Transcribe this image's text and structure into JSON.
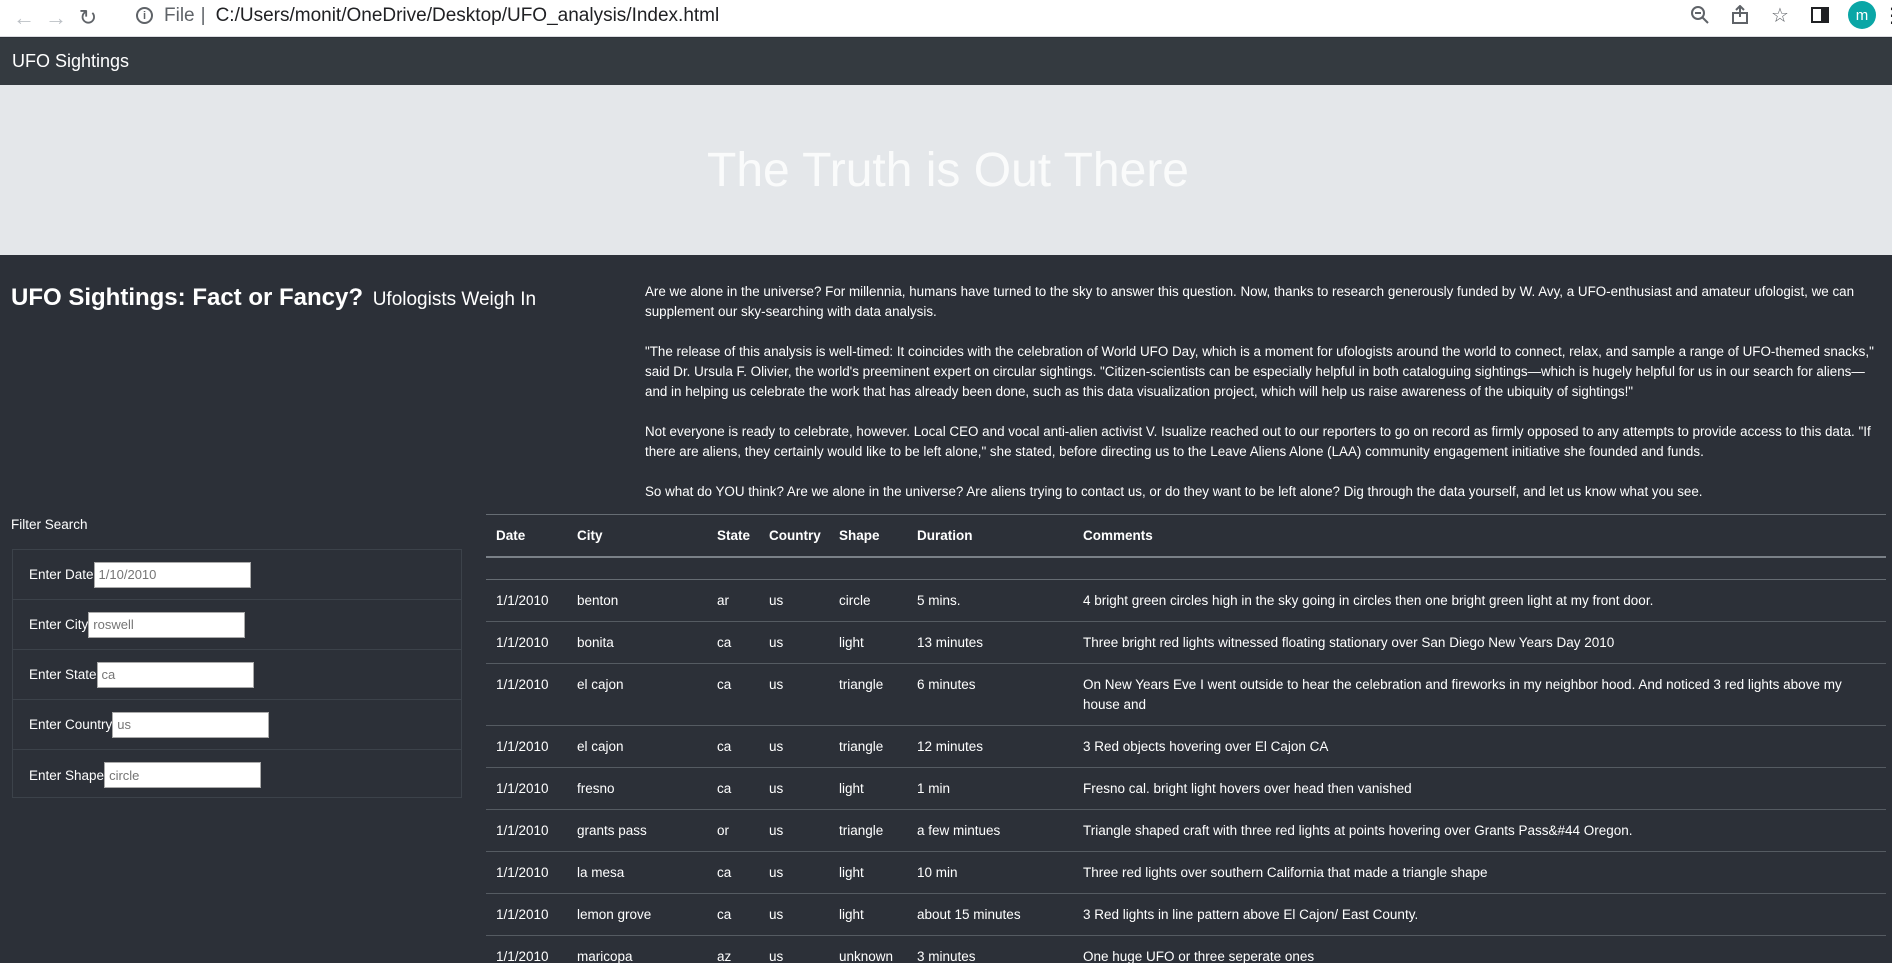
{
  "browser": {
    "file_label": "File",
    "separator": "|",
    "url": "C:/Users/monit/OneDrive/Desktop/UFO_analysis/Index.html",
    "profile_initial": "m",
    "icons": [
      "back-arrow-icon",
      "forward-arrow-icon",
      "reload-icon",
      "info-icon",
      "zoom-out-icon",
      "share-icon",
      "star-icon",
      "side-panel-icon",
      "kebab-menu-icon"
    ]
  },
  "navbar": {
    "brand": "UFO Sightings"
  },
  "jumbotron": {
    "title": "The Truth is Out There"
  },
  "article": {
    "title": "UFO Sightings: Fact or Fancy?",
    "subtitle": "Ufologists Weigh In",
    "paragraphs": [
      "Are we alone in the universe? For millennia, humans have turned to the sky to answer this question. Now, thanks to research generously funded by W. Avy, a UFO-enthusiast and amateur ufologist, we can supplement our sky-searching with data analysis.",
      "\"The release of this analysis is well-timed: It coincides with the celebration of World UFO Day, which is a moment for ufologists around the world to connect, relax, and sample a range of UFO-themed snacks,\" said Dr. Ursula F. Olivier, the world's preeminent expert on circular sightings. \"Citizen-scientists can be especially helpful in both cataloguing sightings—which is hugely helpful for us in our search for aliens—and in helping us celebrate the work that has already been done, such as this data visualization project, which will help us raise awareness of the ubiquity of sightings!\"",
      "Not everyone is ready to celebrate, however. Local CEO and vocal anti-alien activist V. Isualize reached out to our reporters to go on record as firmly opposed to any attempts to provide access to this data. \"If there are aliens, they certainly would like to be left alone,\" she stated, before directing us to the Leave Aliens Alone (LAA) community engagement initiative she founded and funds.",
      "So what do YOU think? Are we alone in the universe? Are aliens trying to contact us, or do they want to be left alone? Dig through the data yourself, and let us know what you see."
    ]
  },
  "filters": {
    "title": "Filter Search",
    "items": [
      {
        "label": "Enter Date",
        "placeholder": "1/10/2010"
      },
      {
        "label": "Enter City",
        "placeholder": "roswell"
      },
      {
        "label": "Enter State",
        "placeholder": "ca"
      },
      {
        "label": "Enter Country",
        "placeholder": "us"
      },
      {
        "label": "Enter Shape",
        "placeholder": "circle"
      }
    ]
  },
  "table": {
    "headers": [
      "Date",
      "City",
      "State",
      "Country",
      "Shape",
      "Duration",
      "Comments"
    ],
    "rows": [
      [
        "1/1/2010",
        "benton",
        "ar",
        "us",
        "circle",
        "5 mins.",
        "4 bright green circles high in the sky going in circles then one bright green light at my front door."
      ],
      [
        "1/1/2010",
        "bonita",
        "ca",
        "us",
        "light",
        "13 minutes",
        "Three bright red lights witnessed floating stationary over San Diego New Years Day 2010"
      ],
      [
        "1/1/2010",
        "el cajon",
        "ca",
        "us",
        "triangle",
        "6 minutes",
        "On New Years Eve I went outside to hear the celebration and fireworks in my neighbor hood. And noticed 3 red lights above my house and"
      ],
      [
        "1/1/2010",
        "el cajon",
        "ca",
        "us",
        "triangle",
        "12 minutes",
        "3 Red objects hovering over El Cajon CA"
      ],
      [
        "1/1/2010",
        "fresno",
        "ca",
        "us",
        "light",
        "1 min",
        "Fresno cal. bright light hovers over head then vanished"
      ],
      [
        "1/1/2010",
        "grants pass",
        "or",
        "us",
        "triangle",
        "a few mintues",
        "Triangle shaped craft with three red lights at points hovering over Grants Pass&#44 Oregon."
      ],
      [
        "1/1/2010",
        "la mesa",
        "ca",
        "us",
        "light",
        "10 min",
        "Three red lights over southern California that made a triangle shape"
      ],
      [
        "1/1/2010",
        "lemon grove",
        "ca",
        "us",
        "light",
        "about 15 minutes",
        "3 Red lights in line pattern above El Cajon/ East County."
      ],
      [
        "1/1/2010",
        "maricopa",
        "az",
        "us",
        "unknown",
        "3 minutes",
        "One huge UFO or three seperate ones"
      ]
    ]
  }
}
